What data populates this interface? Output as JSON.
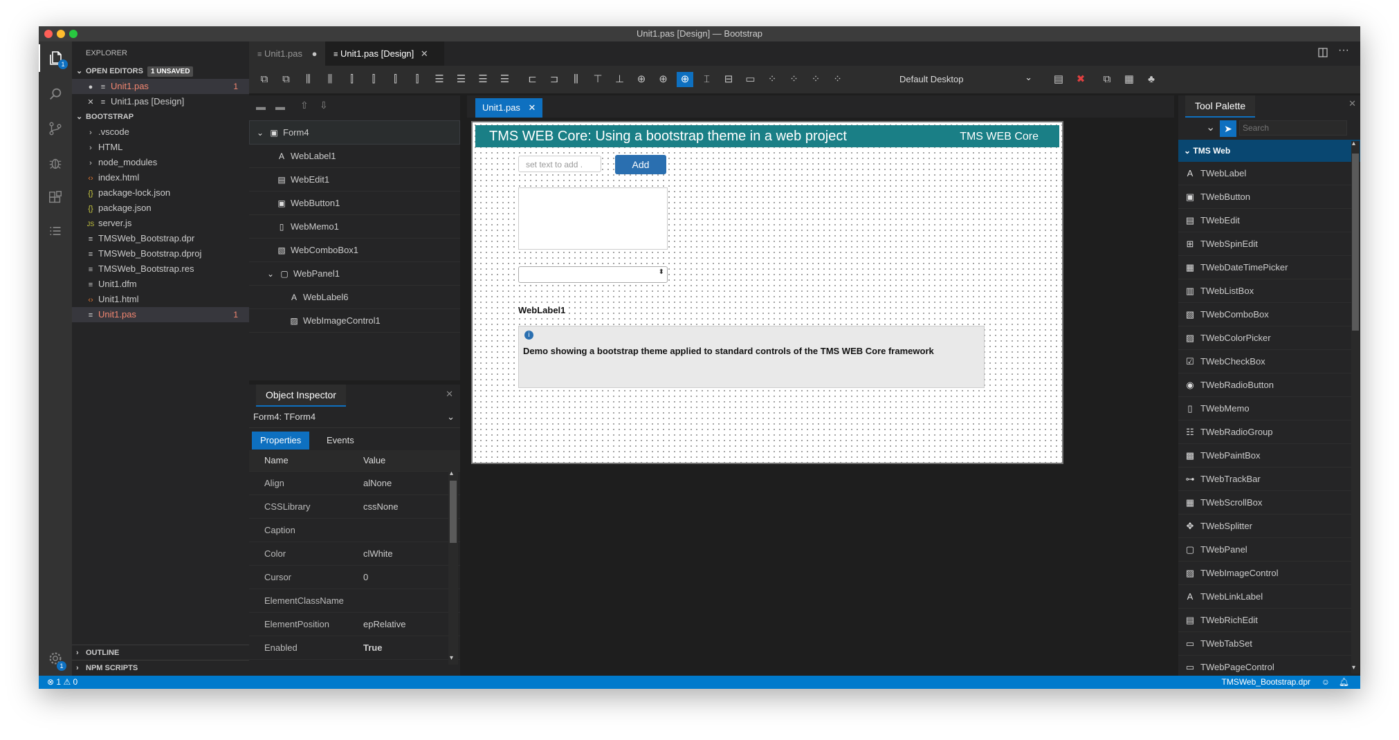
{
  "window": {
    "title": "Unit1.pas [Design] — Bootstrap"
  },
  "sidebar": {
    "header": "EXPLORER",
    "open_editors": {
      "label": "OPEN EDITORS",
      "badge": "1 UNSAVED",
      "items": [
        {
          "name": "Unit1.pas",
          "count": "1"
        },
        {
          "name": "Unit1.pas [Design]"
        }
      ]
    },
    "project": {
      "label": "BOOTSTRAP",
      "items": [
        {
          "name": ".vscode",
          "kind": "folder"
        },
        {
          "name": "HTML",
          "kind": "folder"
        },
        {
          "name": "node_modules",
          "kind": "folder"
        },
        {
          "name": "index.html",
          "kind": "html"
        },
        {
          "name": "package-lock.json",
          "kind": "json"
        },
        {
          "name": "package.json",
          "kind": "json"
        },
        {
          "name": "server.js",
          "kind": "js"
        },
        {
          "name": "TMSWeb_Bootstrap.dpr",
          "kind": "file"
        },
        {
          "name": "TMSWeb_Bootstrap.dproj",
          "kind": "file"
        },
        {
          "name": "TMSWeb_Bootstrap.res",
          "kind": "file"
        },
        {
          "name": "Unit1.dfm",
          "kind": "file"
        },
        {
          "name": "Unit1.html",
          "kind": "html"
        },
        {
          "name": "Unit1.pas",
          "kind": "file",
          "count": "1"
        }
      ]
    },
    "outline": "OUTLINE",
    "npm": "NPM SCRIPTS"
  },
  "tabs": [
    {
      "label": "Unit1.pas"
    },
    {
      "label": "Unit1.pas [Design]"
    }
  ],
  "toolbar": {
    "layout_select": "Default Desktop"
  },
  "structure": {
    "nodes": [
      {
        "label": "Form4",
        "icon": "form-icon"
      },
      {
        "label": "WebLabel1",
        "icon": "label-icon"
      },
      {
        "label": "WebEdit1",
        "icon": "edit-icon"
      },
      {
        "label": "WebButton1",
        "icon": "button-icon"
      },
      {
        "label": "WebMemo1",
        "icon": "memo-icon"
      },
      {
        "label": "WebComboBox1",
        "icon": "combobox-icon"
      },
      {
        "label": "WebPanel1",
        "icon": "panel-icon"
      },
      {
        "label": "WebLabel6",
        "icon": "label-icon"
      },
      {
        "label": "WebImageControl1",
        "icon": "image-icon"
      }
    ]
  },
  "inspector": {
    "title": "Object Inspector",
    "object": "Form4: TForm4",
    "tabs": [
      "Properties",
      "Events"
    ],
    "col_name": "Name",
    "col_value": "Value",
    "props": [
      {
        "name": "Align",
        "value": "alNone"
      },
      {
        "name": "CSSLibrary",
        "value": "cssNone"
      },
      {
        "name": "Caption",
        "value": ""
      },
      {
        "name": "Color",
        "value": "clWhite"
      },
      {
        "name": "Cursor",
        "value": "0"
      },
      {
        "name": "ElementClassName",
        "value": ""
      },
      {
        "name": "ElementPosition",
        "value": "epRelative"
      },
      {
        "name": "Enabled",
        "value": "True"
      }
    ]
  },
  "designer": {
    "tab": "Unit1.pas",
    "form": {
      "header_title": "TMS WEB Core: Using a bootstrap theme in a web project",
      "header_right": "TMS WEB Core",
      "edit_placeholder": "set text to add .",
      "add_button": "Add",
      "label": "WebLabel1",
      "panel_text": "Demo showing a bootstrap theme applied to standard controls of the TMS WEB Core framework"
    }
  },
  "palette": {
    "title": "Tool Palette",
    "search_placeholder": "Search",
    "category": "TMS Web",
    "items": [
      {
        "label": "TWebLabel",
        "icon": "A"
      },
      {
        "label": "TWebButton",
        "icon": "▣"
      },
      {
        "label": "TWebEdit",
        "icon": "▤"
      },
      {
        "label": "TWebSpinEdit",
        "icon": "⊞"
      },
      {
        "label": "TWebDateTimePicker",
        "icon": "▦"
      },
      {
        "label": "TWebListBox",
        "icon": "▥"
      },
      {
        "label": "TWebComboBox",
        "icon": "▧"
      },
      {
        "label": "TWebColorPicker",
        "icon": "▨"
      },
      {
        "label": "TWebCheckBox",
        "icon": "☑"
      },
      {
        "label": "TWebRadioButton",
        "icon": "◉"
      },
      {
        "label": "TWebMemo",
        "icon": "▯"
      },
      {
        "label": "TWebRadioGroup",
        "icon": "☷"
      },
      {
        "label": "TWebPaintBox",
        "icon": "▩"
      },
      {
        "label": "TWebTrackBar",
        "icon": "⊶"
      },
      {
        "label": "TWebScrollBox",
        "icon": "▦"
      },
      {
        "label": "TWebSplitter",
        "icon": "✥"
      },
      {
        "label": "TWebPanel",
        "icon": "▢"
      },
      {
        "label": "TWebImageControl",
        "icon": "▨"
      },
      {
        "label": "TWebLinkLabel",
        "icon": "A"
      },
      {
        "label": "TWebRichEdit",
        "icon": "▤"
      },
      {
        "label": "TWebTabSet",
        "icon": "▭"
      },
      {
        "label": "TWebPageControl",
        "icon": "▭"
      }
    ]
  },
  "status": {
    "errors": "1",
    "warnings": "0",
    "project": "TMSWeb_Bootstrap.dpr"
  },
  "colors": {
    "accent": "#007acc",
    "form_header": "#1a7f86"
  }
}
